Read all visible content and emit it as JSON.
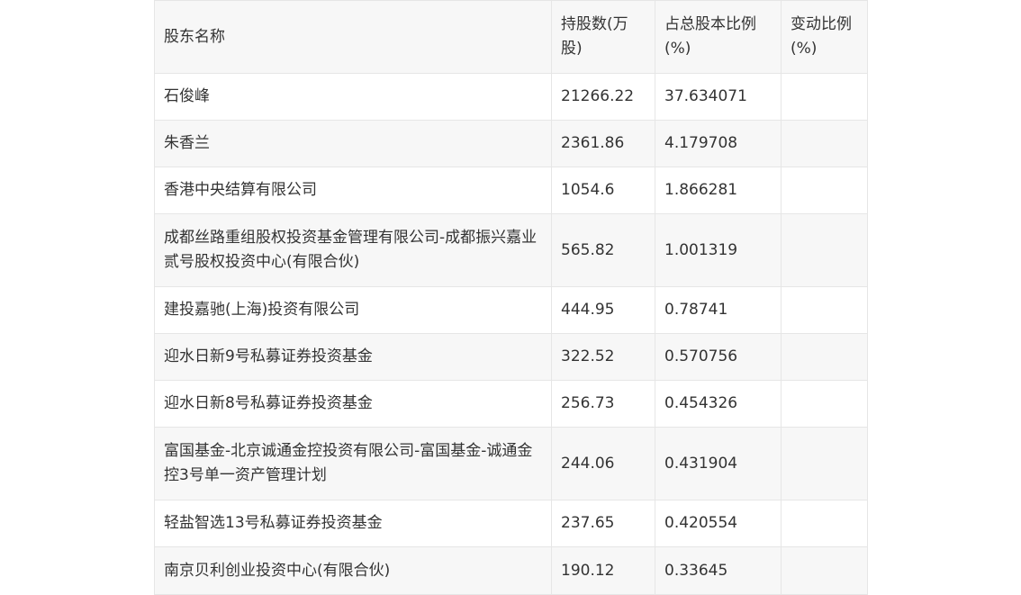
{
  "table": {
    "headers": [
      "股东名称",
      "持股数(万股)",
      "占总股本比例(%)",
      "变动比例(%)"
    ],
    "rows": [
      {
        "name": "石俊峰",
        "shares": "21266.22",
        "ratio": "37.634071",
        "change": ""
      },
      {
        "name": "朱香兰",
        "shares": "2361.86",
        "ratio": "4.179708",
        "change": ""
      },
      {
        "name": "香港中央结算有限公司",
        "shares": "1054.6",
        "ratio": "1.866281",
        "change": ""
      },
      {
        "name": "成都丝路重组股权投资基金管理有限公司-成都振兴嘉业贰号股权投资中心(有限合伙)",
        "shares": "565.82",
        "ratio": "1.001319",
        "change": ""
      },
      {
        "name": "建投嘉驰(上海)投资有限公司",
        "shares": "444.95",
        "ratio": "0.78741",
        "change": ""
      },
      {
        "name": "迎水日新9号私募证券投资基金",
        "shares": "322.52",
        "ratio": "0.570756",
        "change": ""
      },
      {
        "name": "迎水日新8号私募证券投资基金",
        "shares": "256.73",
        "ratio": "0.454326",
        "change": ""
      },
      {
        "name": "富国基金-北京诚通金控投资有限公司-富国基金-诚通金控3号单一资产管理计划",
        "shares": "244.06",
        "ratio": "0.431904",
        "change": ""
      },
      {
        "name": "轻盐智选13号私募证券投资基金",
        "shares": "237.65",
        "ratio": "0.420554",
        "change": ""
      },
      {
        "name": "南京贝利创业投资中心(有限合伙)",
        "shares": "190.12",
        "ratio": "0.33645",
        "change": ""
      }
    ]
  }
}
